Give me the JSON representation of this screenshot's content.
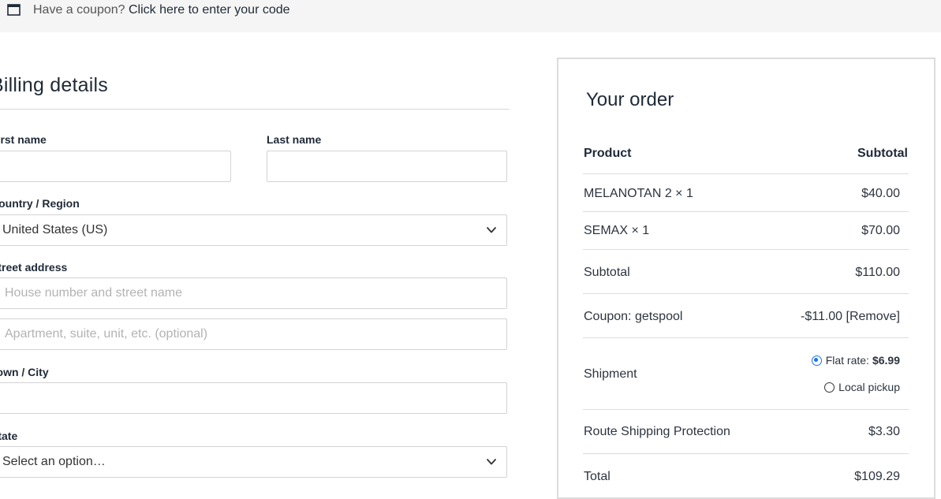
{
  "coupon": {
    "prompt": "Have a coupon?",
    "link": "Click here to enter your code"
  },
  "billing": {
    "title": "Billing details",
    "first_name_label": "First name",
    "last_name_label": "Last name",
    "country_label": "Country / Region",
    "country_value": "United States (US)",
    "street_label": "Street address",
    "street_placeholder": "House number and street name",
    "street2_placeholder": "Apartment, suite, unit, etc. (optional)",
    "city_label": "Town / City",
    "state_label": "State",
    "state_value": "Select an option…"
  },
  "order": {
    "title": "Your order",
    "header": {
      "product": "Product",
      "subtotal": "Subtotal"
    },
    "items": [
      {
        "name": "MELANOTAN 2 × 1",
        "price": "$40.00"
      },
      {
        "name": "SEMAX × 1",
        "price": "$70.00"
      }
    ],
    "subtotal_label": "Subtotal",
    "subtotal_value": "$110.00",
    "coupon_label": "Coupon: getspool",
    "coupon_value": "-$11.00",
    "coupon_remove": "[Remove]",
    "shipment_label": "Shipment",
    "shipping_options": [
      {
        "label": "Flat rate:",
        "price": "$6.99",
        "selected": true
      },
      {
        "label": "Local pickup",
        "price": "",
        "selected": false
      }
    ],
    "protection_label": "Route Shipping Protection",
    "protection_value": "$3.30",
    "total_label": "Total",
    "total_value": "$109.29"
  },
  "colors": {
    "accent": "#1a73e8",
    "text": "#1f2a37",
    "border": "#d3d3d3"
  },
  "icons": {
    "coupon": "window-icon",
    "dropdown": "chevron-down-icon"
  }
}
